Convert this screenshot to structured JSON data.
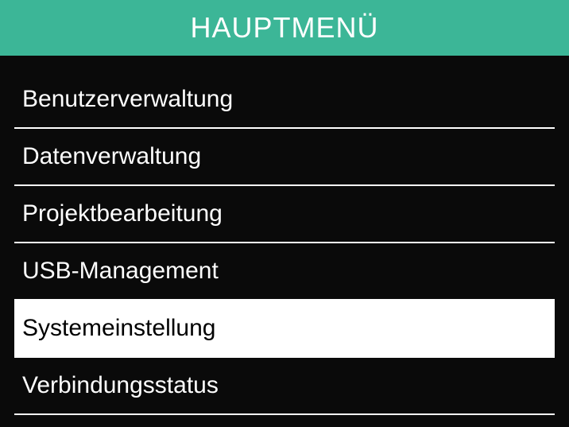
{
  "header": {
    "title": "HAUPTMENÜ"
  },
  "menu": {
    "items": [
      {
        "label": "Benutzerverwaltung",
        "selected": false
      },
      {
        "label": "Datenverwaltung",
        "selected": false
      },
      {
        "label": "Projektbearbeitung",
        "selected": false
      },
      {
        "label": "USB-Management",
        "selected": false
      },
      {
        "label": "Systemeinstellung",
        "selected": true
      },
      {
        "label": "Verbindungsstatus",
        "selected": false
      }
    ]
  }
}
